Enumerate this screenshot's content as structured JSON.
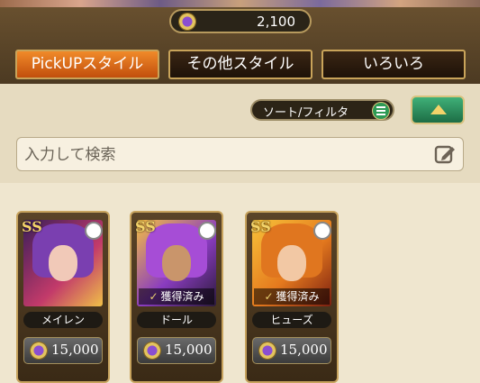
{
  "currency": {
    "icon": "gem-coin-icon",
    "amount": "2,100"
  },
  "tabs": [
    {
      "label": "PickUPスタイル",
      "active": true
    },
    {
      "label": "その他スタイル",
      "active": false
    },
    {
      "label": "いろいろ",
      "active": false
    }
  ],
  "toolbar": {
    "sort_label": "ソート/フィルタ",
    "collapse_icon": "triangle-up-icon"
  },
  "search": {
    "placeholder": "入力して検索",
    "value": "",
    "icon": "edit-icon"
  },
  "cards": [
    {
      "name": "メイレン",
      "price": "15,000",
      "owned": false,
      "owned_label": "",
      "rank": "SS"
    },
    {
      "name": "ドール",
      "price": "15,000",
      "owned": true,
      "owned_label": "獲得済み",
      "rank": "SS"
    },
    {
      "name": "ヒューズ",
      "price": "15,000",
      "owned": true,
      "owned_label": "獲得済み",
      "rank": "SS"
    }
  ],
  "colors": {
    "tab_active": "#e06a1c",
    "tab_inactive": "#2a1a0c",
    "accent_green": "#2e9a55"
  }
}
